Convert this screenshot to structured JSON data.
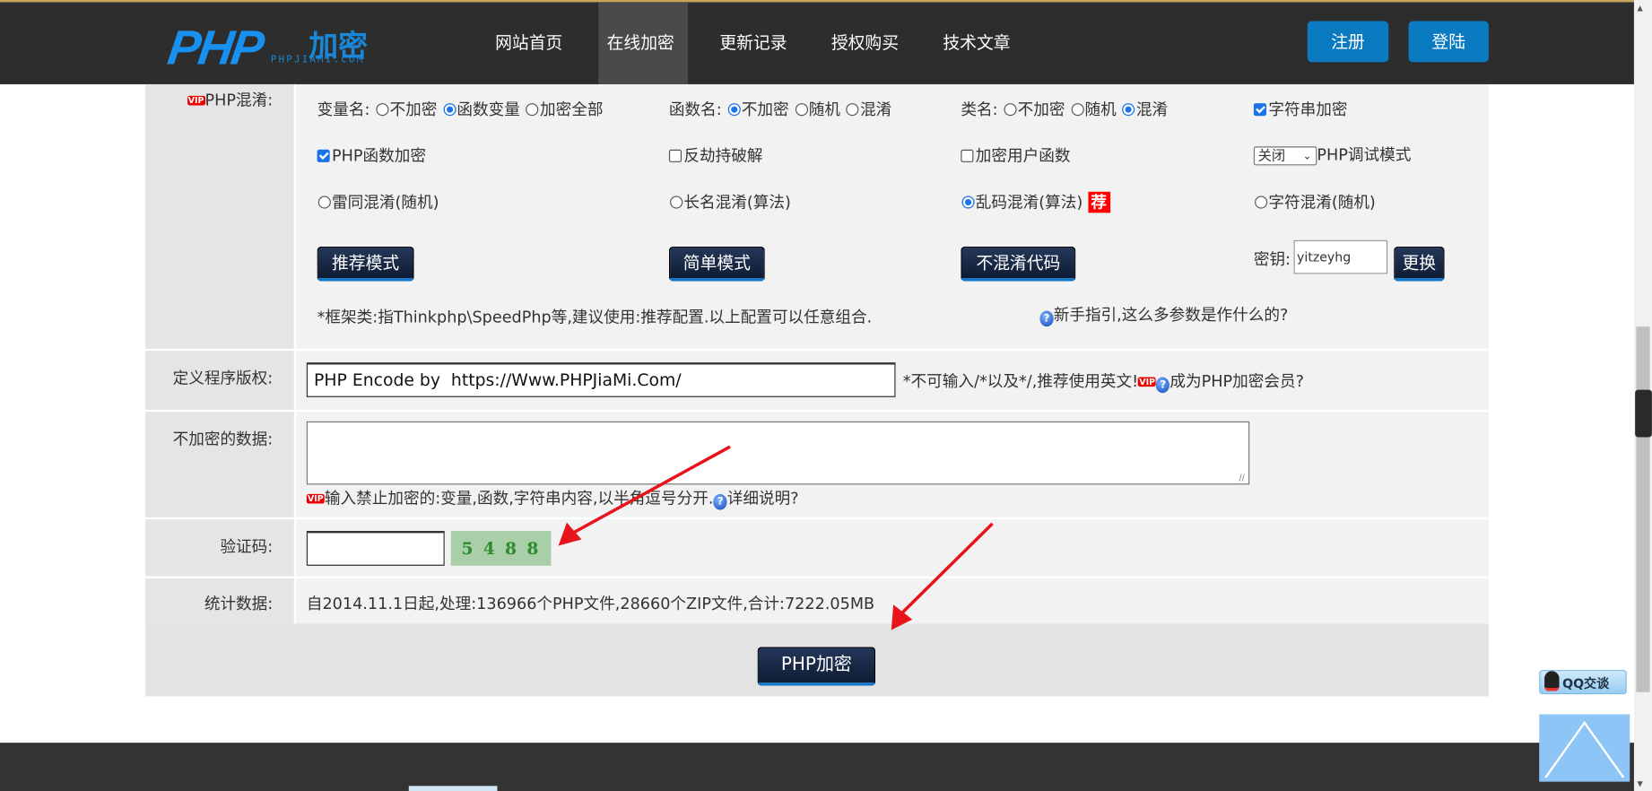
{
  "header": {
    "logo_text": "PHP",
    "logo_cn": "加密",
    "logo_url": "PHPJIAMI.COM",
    "nav": [
      "网站首页",
      "在线加密",
      "更新记录",
      "授权购买",
      "技术文章"
    ],
    "active_nav": "在线加密",
    "register": "注册",
    "login": "登陆"
  },
  "obfuscation": {
    "label": "PHP混淆:",
    "vip_badge": "VIP",
    "var_name": {
      "label": "变量名:",
      "options": [
        "不加密",
        "函数变量",
        "加密全部"
      ],
      "selected": "函数变量"
    },
    "func_name": {
      "label": "函数名:",
      "options": [
        "不加密",
        "随机",
        "混淆"
      ],
      "selected": "不加密"
    },
    "class_name": {
      "label": "类名:",
      "options": [
        "不加密",
        "随机",
        "混淆"
      ],
      "selected": "混淆"
    },
    "string_encrypt": {
      "label": "字符串加密",
      "checked": true
    },
    "php_func_encrypt": {
      "label": "PHP函数加密",
      "checked": true
    },
    "anti_hijack": {
      "label": "反劫持破解",
      "checked": false
    },
    "encrypt_user_func": {
      "label": "加密用户函数",
      "checked": false
    },
    "debug_mode": {
      "value": "关闭",
      "label": "PHP调试模式"
    },
    "modes": [
      "雷同混淆(随机)",
      "长名混淆(算法)",
      "乱码混淆(算法)",
      "字符混淆(随机)"
    ],
    "mode_selected": "乱码混淆(算法)",
    "recommend_badge": "荐",
    "buttons": [
      "推荐模式",
      "简单模式",
      "不混淆代码"
    ],
    "key_label": "密钥:",
    "key_value": "yitzeyhg",
    "change_button": "更换",
    "note": "*框架类:指Thinkphp\\SpeedPhp等,建议使用:推荐配置.以上配置可以任意组合.",
    "guide_link": "新手指引,这么多参数是作什么的?"
  },
  "copyright": {
    "label": "定义程序版权:",
    "value": "PHP Encode by  https://Www.PHPJiaMi.Com/",
    "hint": "*不可输入/*以及*/,推荐使用英文!",
    "member_link": "成为PHP加密会员?"
  },
  "exclude": {
    "label": "不加密的数据:",
    "value": "",
    "hint": "输入禁止加密的:变量,函数,字符串内容,以半角逗号分开.",
    "detail_link": "详细说明?"
  },
  "captcha": {
    "label": "验证码:",
    "value": "",
    "image_text": "5 4 8 8"
  },
  "stats": {
    "label": "统计数据:",
    "text": "自2014.11.1日起,处理:136966个PHP文件,28660个ZIP文件,合计:7222.05MB"
  },
  "submit": "PHP加密",
  "float": {
    "qq": "QQ交谈"
  },
  "colors": {
    "header_bg": "#2d2d2d",
    "accent": "#0a7bc1",
    "button_dark": "#142541",
    "arrow": "#e8141b"
  }
}
